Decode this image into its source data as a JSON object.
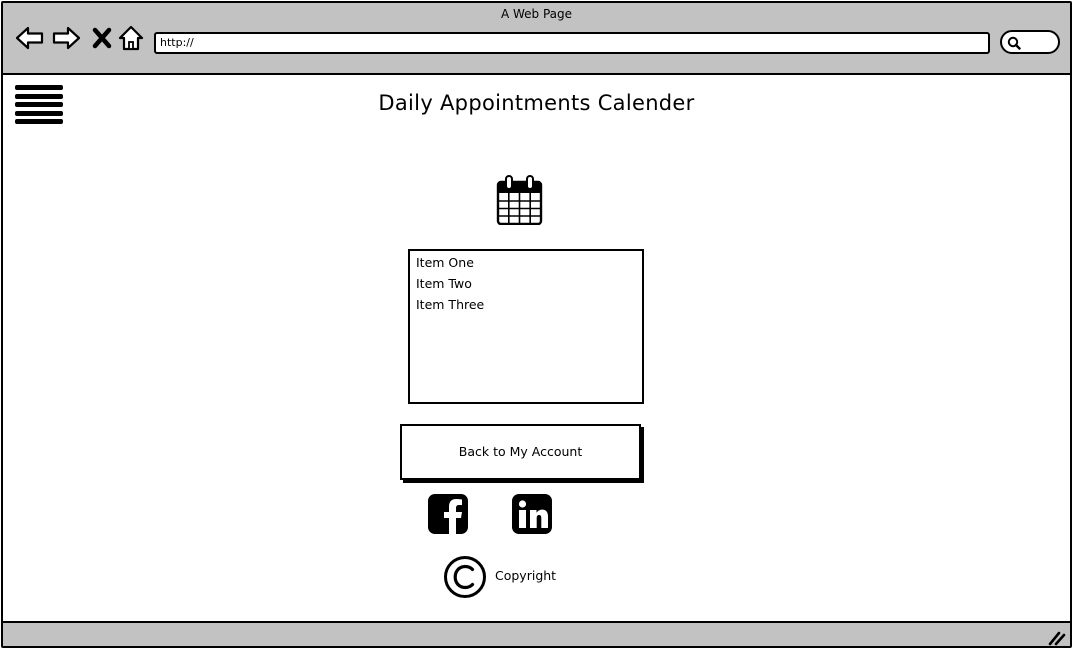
{
  "window": {
    "title": "A Web Page",
    "url": "http://"
  },
  "page": {
    "title": "Daily Appointments Calender"
  },
  "list": {
    "items": [
      "Item One",
      "Item Two",
      "Item Three"
    ]
  },
  "back_button": {
    "label": "Back to My Account"
  },
  "footer": {
    "copyright": "Copyright"
  },
  "icons": {
    "back": "arrow-left-icon",
    "forward": "arrow-right-icon",
    "stop": "close-icon",
    "home": "home-icon",
    "search": "search-icon",
    "menu": "hamburger-menu-icon",
    "calendar": "calendar-icon",
    "facebook": "facebook-icon",
    "linkedin": "linkedin-icon",
    "copyright": "copyright-icon",
    "resize": "resize-grip-icon"
  },
  "colors": {
    "chrome": "#c2c2c2",
    "background": "#ffffff",
    "ink": "#000000"
  }
}
